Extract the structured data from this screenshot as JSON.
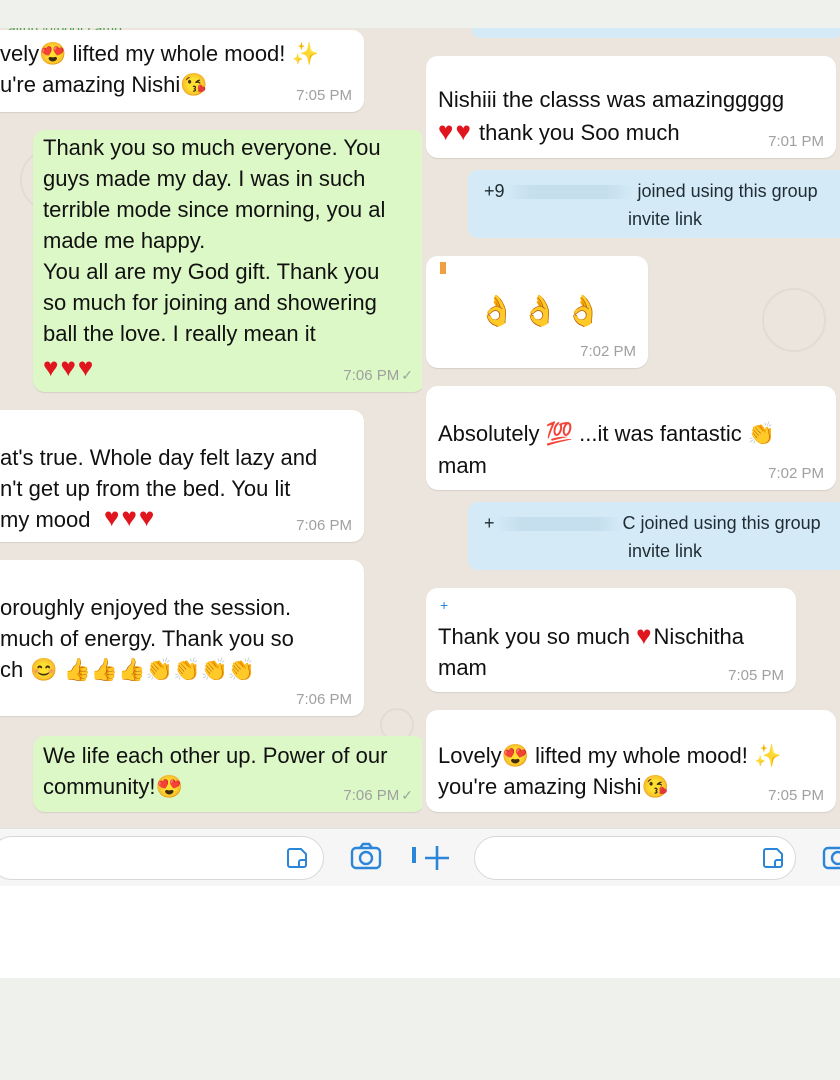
{
  "left": {
    "header_fragment": "aithu @boot camp",
    "messages": [
      {
        "line1": "vely",
        "line1b": " lifted my whole mood! ",
        "line2": "u're amazing Nishi",
        "time": "7:05 PM"
      },
      {
        "text": "Thank you so much everyone. You\nguys made my day. I was in such\nterrible mode since morning, you al\nmade me happy.\nYou all are my God gift. Thank you\nso much for joining and showering\nball the love. I really mean it",
        "hearts": "♥♥♥",
        "time": "7:06 PM",
        "tick": "✓"
      },
      {
        "text": "at's true. Whole day felt lazy and\nn't get up from the bed. You lit\nmy mood",
        "hearts": "♥♥♥",
        "time": "7:06 PM"
      },
      {
        "text": "oroughly enjoyed the session.\nmuch of energy. Thank you so\nch",
        "emojis": "😊 👍👍👍👏👏👏👏",
        "time": "7:06 PM"
      },
      {
        "text": "We life each other up. Power of our\ncommunity!",
        "emoji": "😍",
        "time": "7:06 PM",
        "tick": "✓"
      }
    ]
  },
  "right": {
    "messages": [
      {
        "text": "Nishiii the classs was amazinggggg",
        "line2": "thank you Soo much",
        "hearts": "♥♥",
        "time": "7:01 PM"
      },
      {
        "sys_prefix": "+9",
        "sys_suffix": " joined using this group",
        "sys_line2": "invite link"
      },
      {
        "emojis": "👌👌👌",
        "time": "7:02 PM"
      },
      {
        "text": "Absolutely",
        "emoji": "💯",
        "text_b": "  ...it was fantastic",
        "emoji_b": "👏",
        "line2": "mam",
        "time": "7:02 PM"
      },
      {
        "sys_prefix": "+",
        "sys_suffix": "C joined using this group",
        "sys_line2": "invite link"
      },
      {
        "sender": "+",
        "text": "Thank you so much",
        "heart": "♥",
        "text_b": "Nischitha",
        "line2": "mam",
        "time": "7:05 PM"
      },
      {
        "line1": "Lovely",
        "line1b": " lifted my whole mood! ",
        "line2": "you're amazing Nishi",
        "time": "7:05 PM"
      }
    ]
  },
  "icons": {
    "sticker": "sticker-icon",
    "camera": "camera-icon",
    "plus": "plus-icon",
    "love_face": "😍",
    "kiss_face": "😘",
    "sparkles": "✨"
  },
  "colors": {
    "incoming": "#ffffff",
    "outgoing": "#dcf8c6",
    "system": "#d4eaf7",
    "accent": "#2b85d8"
  }
}
